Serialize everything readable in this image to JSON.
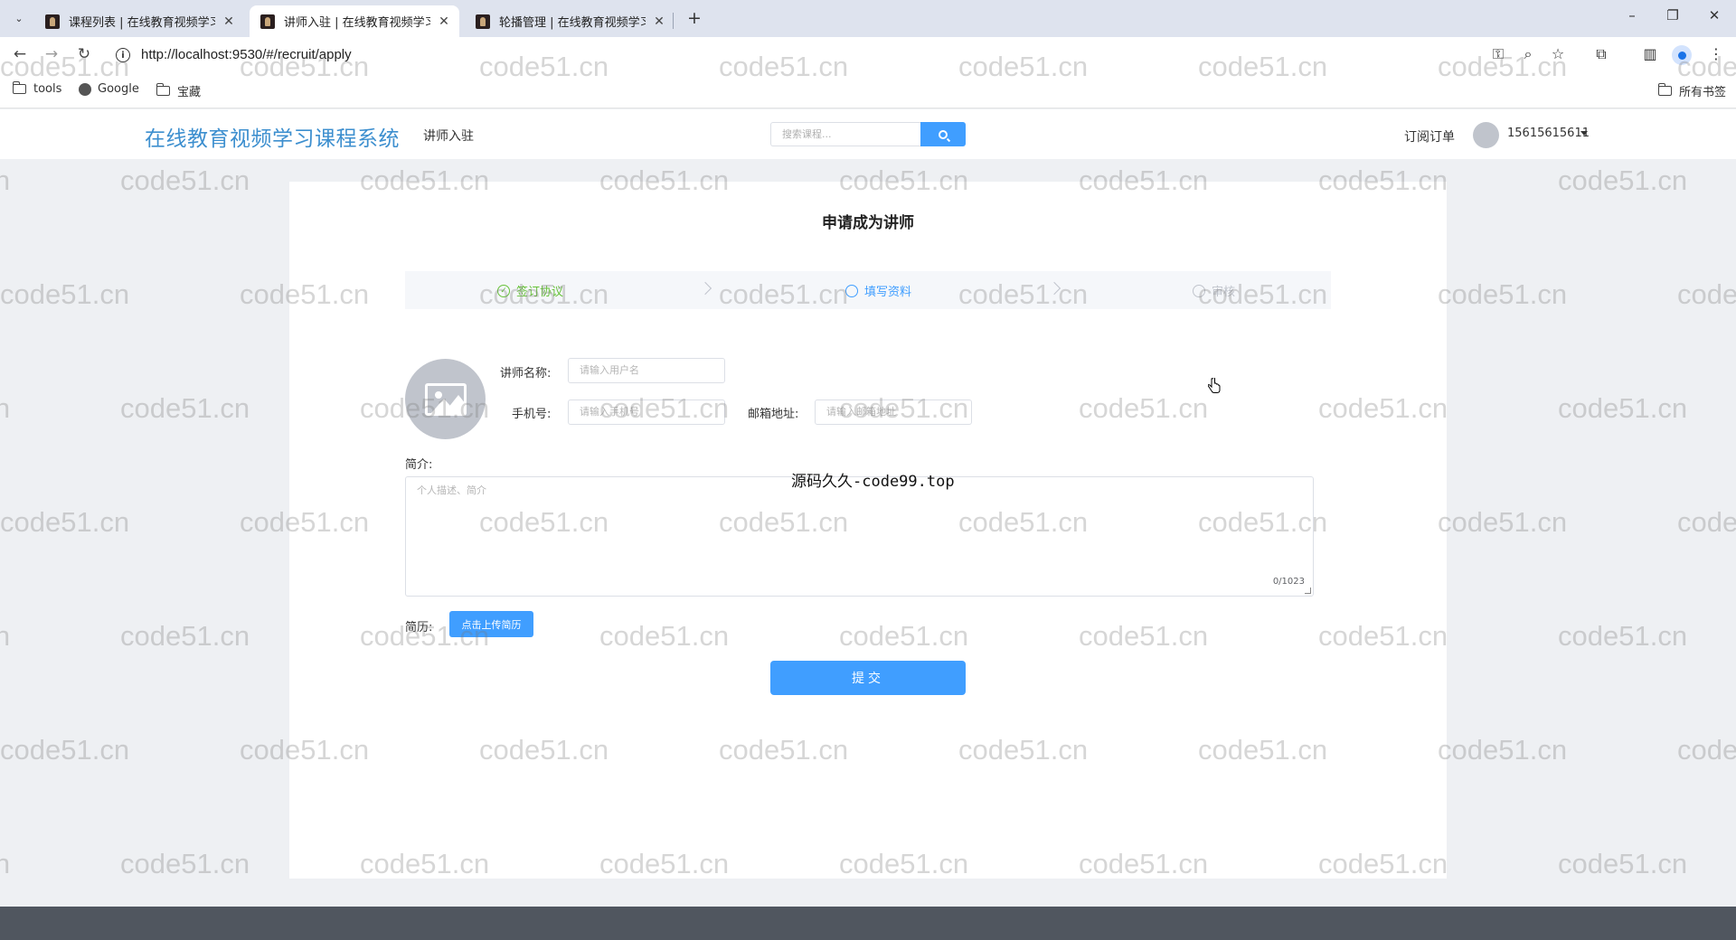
{
  "browser": {
    "tabs": [
      {
        "title": "课程列表 | 在线教育视频学习课",
        "active": false
      },
      {
        "title": "讲师入驻 | 在线教育视频学习课",
        "active": true
      },
      {
        "title": "轮播管理 | 在线教育视频学习课",
        "active": false
      }
    ],
    "url": "http://localhost:9530/#/recruit/apply",
    "bookmarks": [
      {
        "label": "tools",
        "icon": "folder-icon"
      },
      {
        "label": "Google",
        "icon": "globe-icon"
      },
      {
        "label": "宝藏",
        "icon": "folder-icon"
      }
    ],
    "all_bookmarks_label": "所有书签"
  },
  "header": {
    "logo": "在线教育视频学习课程系统",
    "nav_recruit": "讲师入驻",
    "search_placeholder": "搜索课程...",
    "orders_link": "订阅订单",
    "user_phone": "15615615611"
  },
  "page": {
    "title": "申请成为讲师",
    "steps": [
      {
        "label": "签订协议",
        "status": "done"
      },
      {
        "label": "填写资料",
        "status": "current"
      },
      {
        "label": "审核",
        "status": "pending"
      }
    ],
    "form": {
      "name_label": "讲师名称:",
      "name_placeholder": "请输入用户名",
      "phone_label": "手机号:",
      "phone_placeholder": "请输入手机号",
      "email_label": "邮箱地址:",
      "email_placeholder": "请输入邮箱地址",
      "intro_label": "简介:",
      "intro_placeholder": "个人描述、简介",
      "intro_count": "0/1023",
      "resume_label": "简历:",
      "upload_button": "点击上传简历",
      "submit_button": "提交"
    }
  },
  "overlay_text": "源码久久-code99.top",
  "watermark": "code51.cn",
  "colors": {
    "primary": "#409eff",
    "logo": "#3d8fcf",
    "step_done": "#67c23a",
    "footer": "#50565f"
  }
}
